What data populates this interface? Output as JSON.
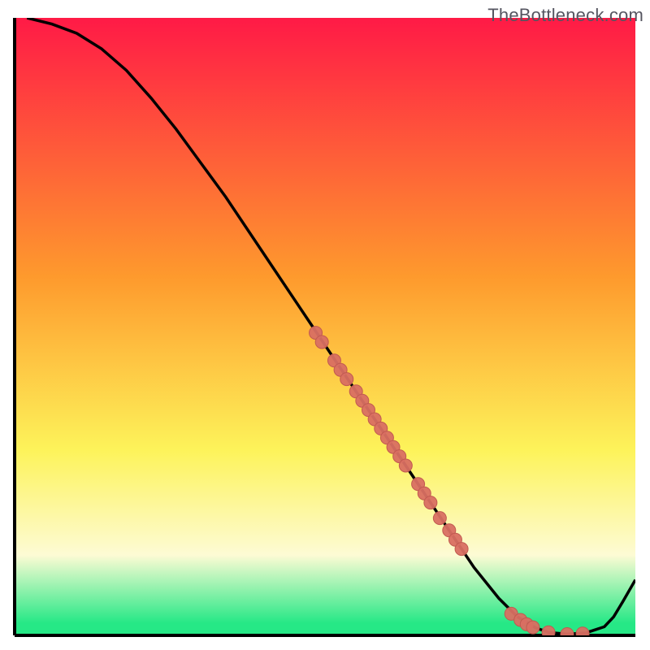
{
  "watermark": "TheBottleneck.com",
  "colors": {
    "gradient_top": "#ff1a46",
    "gradient_mid1": "#fe9a2d",
    "gradient_mid2": "#fdf35a",
    "gradient_band": "#fdfbd4",
    "gradient_bottom": "#26e886",
    "line": "#000000",
    "marker_fill": "#d96f62",
    "marker_stroke": "#c15a50",
    "frame": "#000000"
  },
  "chart_data": {
    "type": "line",
    "title": "",
    "xlabel": "",
    "ylabel": "",
    "xlim": [
      0,
      100
    ],
    "ylim": [
      0,
      100
    ],
    "series": [
      {
        "name": "curve",
        "x": [
          2,
          6,
          10,
          14,
          18,
          22,
          26,
          30,
          34,
          38,
          42,
          46,
          50,
          54,
          58,
          62,
          66,
          70,
          74,
          78,
          81,
          84,
          86,
          89,
          92,
          95,
          96.5,
          98,
          100
        ],
        "y": [
          100,
          99,
          97.5,
          95,
          91.5,
          87,
          82,
          76.5,
          71,
          65,
          59,
          53,
          47,
          41,
          35,
          29,
          23,
          17,
          11,
          6,
          3,
          1.2,
          0.5,
          0.2,
          0.4,
          1.4,
          3,
          5.5,
          9
        ]
      }
    ],
    "markers": [
      {
        "x": 48.5,
        "y": 49
      },
      {
        "x": 49.5,
        "y": 47.5
      },
      {
        "x": 51.5,
        "y": 44.5
      },
      {
        "x": 52.5,
        "y": 43
      },
      {
        "x": 53.5,
        "y": 41.5
      },
      {
        "x": 55,
        "y": 39.5
      },
      {
        "x": 56,
        "y": 38
      },
      {
        "x": 57,
        "y": 36.5
      },
      {
        "x": 58,
        "y": 35
      },
      {
        "x": 59,
        "y": 33.5
      },
      {
        "x": 60,
        "y": 32
      },
      {
        "x": 61,
        "y": 30.5
      },
      {
        "x": 62,
        "y": 29
      },
      {
        "x": 63,
        "y": 27.5
      },
      {
        "x": 65,
        "y": 24.5
      },
      {
        "x": 66,
        "y": 23
      },
      {
        "x": 67,
        "y": 21.5
      },
      {
        "x": 68.5,
        "y": 19
      },
      {
        "x": 70,
        "y": 17
      },
      {
        "x": 71,
        "y": 15.5
      },
      {
        "x": 72,
        "y": 14
      },
      {
        "x": 80,
        "y": 3.5
      },
      {
        "x": 81.5,
        "y": 2.5
      },
      {
        "x": 82.5,
        "y": 1.8
      },
      {
        "x": 83.5,
        "y": 1.3
      },
      {
        "x": 86,
        "y": 0.5
      },
      {
        "x": 89,
        "y": 0.2
      },
      {
        "x": 91.5,
        "y": 0.3
      }
    ]
  }
}
